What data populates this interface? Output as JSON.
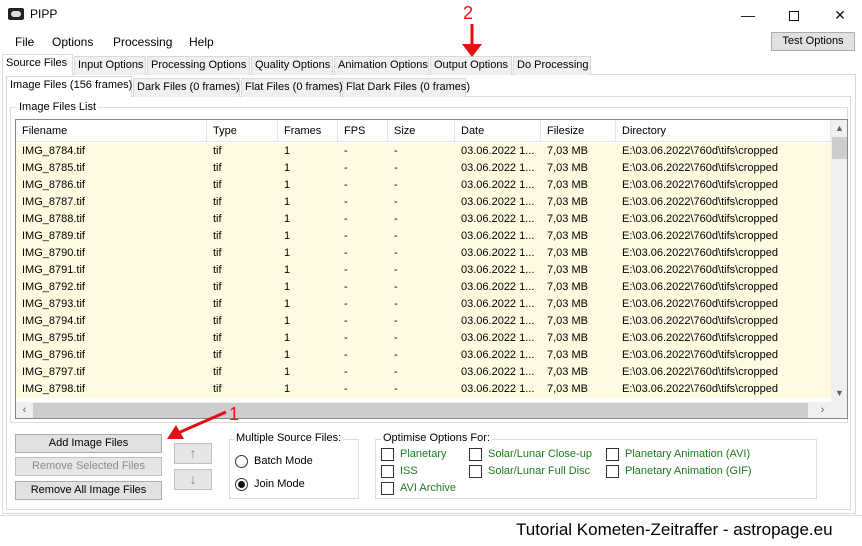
{
  "window": {
    "title": "PIPP",
    "minimize": "—",
    "close": "✕"
  },
  "menu": [
    "File",
    "Options",
    "Processing",
    "Help"
  ],
  "test_button": "Test Options",
  "tabs": [
    "Source Files",
    "Input Options",
    "Processing Options",
    "Quality Options",
    "Animation Options",
    "Output Options",
    "Do Processing"
  ],
  "subtabs": [
    "Image Files (156 frames)",
    "Dark Files (0 frames)",
    "Flat Files (0 frames)",
    "Flat Dark Files (0 frames)"
  ],
  "list": {
    "group_label": "Image Files List",
    "columns": [
      "Filename",
      "Type",
      "Frames",
      "FPS",
      "Size",
      "Date",
      "Filesize",
      "Directory"
    ],
    "rows": [
      [
        "IMG_8784.tif",
        "tif",
        "1",
        "-",
        "-",
        "03.06.2022 1...",
        "7,03 MB",
        "E:\\03.06.2022\\760d\\tifs\\cropped"
      ],
      [
        "IMG_8785.tif",
        "tif",
        "1",
        "-",
        "-",
        "03.06.2022 1...",
        "7,03 MB",
        "E:\\03.06.2022\\760d\\tifs\\cropped"
      ],
      [
        "IMG_8786.tif",
        "tif",
        "1",
        "-",
        "-",
        "03.06.2022 1...",
        "7,03 MB",
        "E:\\03.06.2022\\760d\\tifs\\cropped"
      ],
      [
        "IMG_8787.tif",
        "tif",
        "1",
        "-",
        "-",
        "03.06.2022 1...",
        "7,03 MB",
        "E:\\03.06.2022\\760d\\tifs\\cropped"
      ],
      [
        "IMG_8788.tif",
        "tif",
        "1",
        "-",
        "-",
        "03.06.2022 1...",
        "7,03 MB",
        "E:\\03.06.2022\\760d\\tifs\\cropped"
      ],
      [
        "IMG_8789.tif",
        "tif",
        "1",
        "-",
        "-",
        "03.06.2022 1...",
        "7,03 MB",
        "E:\\03.06.2022\\760d\\tifs\\cropped"
      ],
      [
        "IMG_8790.tif",
        "tif",
        "1",
        "-",
        "-",
        "03.06.2022 1...",
        "7,03 MB",
        "E:\\03.06.2022\\760d\\tifs\\cropped"
      ],
      [
        "IMG_8791.tif",
        "tif",
        "1",
        "-",
        "-",
        "03.06.2022 1...",
        "7,03 MB",
        "E:\\03.06.2022\\760d\\tifs\\cropped"
      ],
      [
        "IMG_8792.tif",
        "tif",
        "1",
        "-",
        "-",
        "03.06.2022 1...",
        "7,03 MB",
        "E:\\03.06.2022\\760d\\tifs\\cropped"
      ],
      [
        "IMG_8793.tif",
        "tif",
        "1",
        "-",
        "-",
        "03.06.2022 1...",
        "7,03 MB",
        "E:\\03.06.2022\\760d\\tifs\\cropped"
      ],
      [
        "IMG_8794.tif",
        "tif",
        "1",
        "-",
        "-",
        "03.06.2022 1...",
        "7,03 MB",
        "E:\\03.06.2022\\760d\\tifs\\cropped"
      ],
      [
        "IMG_8795.tif",
        "tif",
        "1",
        "-",
        "-",
        "03.06.2022 1...",
        "7,03 MB",
        "E:\\03.06.2022\\760d\\tifs\\cropped"
      ],
      [
        "IMG_8796.tif",
        "tif",
        "1",
        "-",
        "-",
        "03.06.2022 1...",
        "7,03 MB",
        "E:\\03.06.2022\\760d\\tifs\\cropped"
      ],
      [
        "IMG_8797.tif",
        "tif",
        "1",
        "-",
        "-",
        "03.06.2022 1...",
        "7,03 MB",
        "E:\\03.06.2022\\760d\\tifs\\cropped"
      ],
      [
        "IMG_8798.tif",
        "tif",
        "1",
        "-",
        "-",
        "03.06.2022 1...",
        "7,03 MB",
        "E:\\03.06.2022\\760d\\tifs\\cropped"
      ]
    ]
  },
  "buttons": {
    "add": "Add Image Files",
    "remove_selected": "Remove Selected Files",
    "remove_all": "Remove All Image Files",
    "move_up": "↑",
    "move_down": "↓"
  },
  "multiple_source": {
    "label": "Multiple Source Files:",
    "batch": "Batch Mode",
    "join": "Join Mode",
    "selected": "join"
  },
  "optimise": {
    "label": "Optimise Options For:",
    "options": [
      "Planetary",
      "ISS",
      "AVI Archive",
      "Solar/Lunar Close-up",
      "Solar/Lunar Full Disc",
      "Planetary Animation (AVI)",
      "Planetary Animation (GIF)"
    ]
  },
  "annotations": {
    "one": "1",
    "two": "2",
    "color": "#e11111"
  },
  "footer": "Tutorial Kometen-Zeitraffer - astropage.eu",
  "colors": {
    "row_highlight": "#fffbe1",
    "option_text": "#1f7a1f"
  }
}
